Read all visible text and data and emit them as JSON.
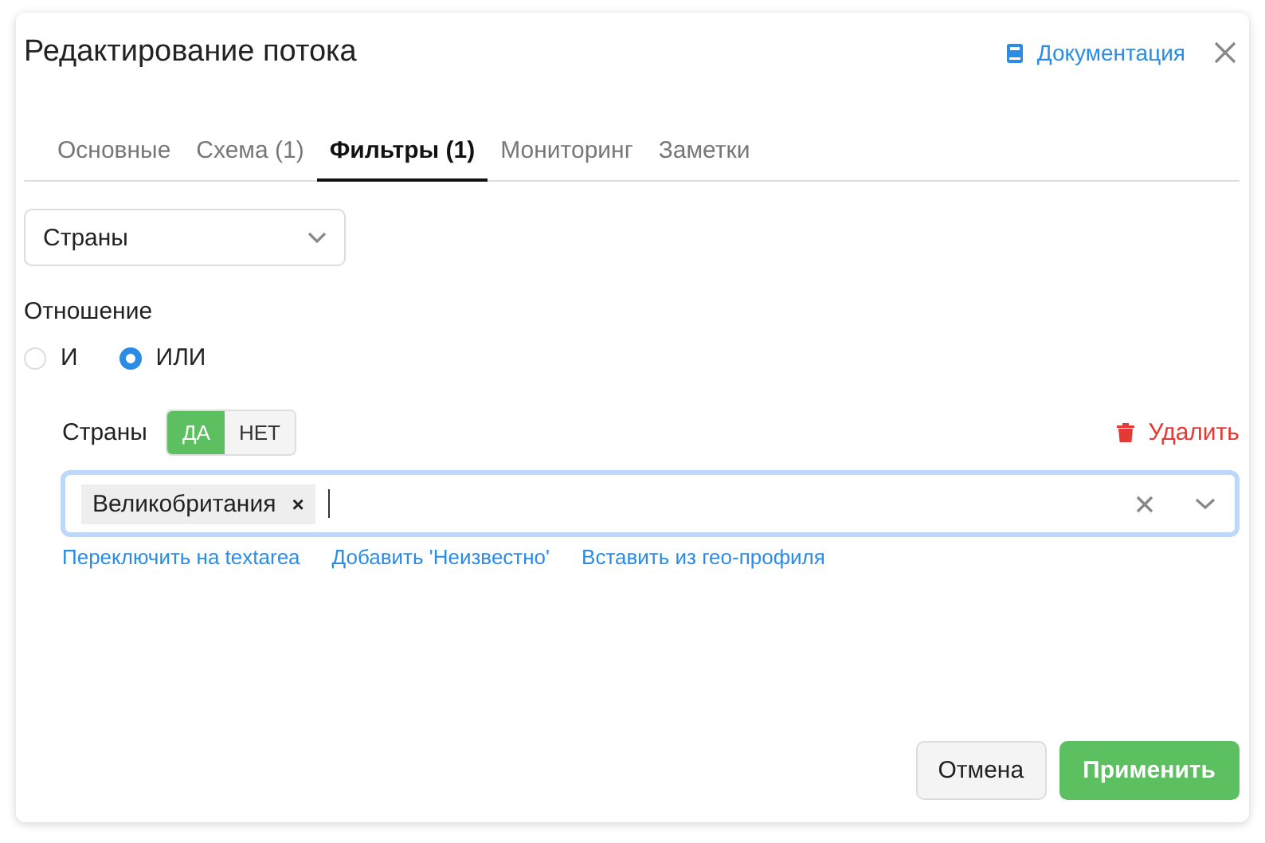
{
  "dialog": {
    "title": "Редактирование потока",
    "doc_link": "Документация"
  },
  "tabs": [
    {
      "label": "Основные",
      "selected": false
    },
    {
      "label": "Схема (1)",
      "selected": false
    },
    {
      "label": "Фильтры (1)",
      "selected": true
    },
    {
      "label": "Мониторинг",
      "selected": false
    },
    {
      "label": "Заметки",
      "selected": false
    }
  ],
  "filter_type_select": {
    "value": "Страны"
  },
  "relation": {
    "label": "Отношение",
    "options": [
      {
        "label": "И",
        "selected": false
      },
      {
        "label": "ИЛИ",
        "selected": true
      }
    ]
  },
  "filter": {
    "label": "Страны",
    "toggle": [
      {
        "label": "ДА",
        "selected": true
      },
      {
        "label": "НЕТ",
        "selected": false
      }
    ],
    "delete": "Удалить",
    "tags": [
      "Великобритания"
    ],
    "tag_remove": "×",
    "links": [
      "Переключить на textarea",
      "Добавить 'Неизвестно'",
      "Вставить из гео-профиля"
    ]
  },
  "buttons": {
    "cancel": "Отмена",
    "apply": "Применить"
  }
}
